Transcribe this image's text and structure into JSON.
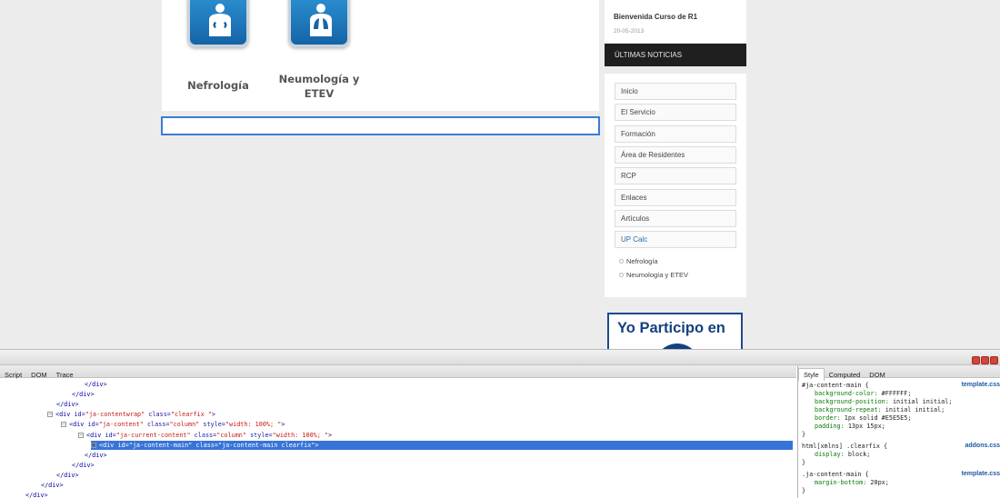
{
  "page": {
    "departments": [
      {
        "name_line1": "Nefrología",
        "name_line2": ""
      },
      {
        "name_line1": "Neumología y",
        "name_line2": "ETEV"
      }
    ],
    "welcome": {
      "title": "Bienvenida Curso de R1",
      "date": "20-05-2013"
    },
    "news_header": "ÚLTIMAS NOTICIAS",
    "menu": [
      "Inicio",
      "El Servicio",
      "Formación",
      "Área de Residentes",
      "RCP",
      "Enlaces",
      "Artículos",
      "UP Calc"
    ],
    "submenu": [
      "Nefrología",
      "Neumología y ETEV"
    ],
    "banner": "Yo Participo en"
  },
  "devtools": {
    "tabs": [
      "Script",
      "DOM",
      "Trace"
    ],
    "tree": [
      {
        "indent": 93,
        "close": "</div>"
      },
      {
        "indent": 79,
        "close": "</div>"
      },
      {
        "indent": 62,
        "close": "</div>"
      },
      {
        "indent": 52,
        "toggle": "−",
        "tag": "div",
        "attrs": [
          [
            "id",
            "ja-contentwrap"
          ],
          [
            "class",
            "clearfix "
          ]
        ]
      },
      {
        "indent": 67,
        "toggle": "−",
        "tag": "div",
        "attrs": [
          [
            "id",
            "ja-content"
          ],
          [
            "class",
            "column"
          ],
          [
            "style",
            "width: 100%; "
          ]
        ]
      },
      {
        "indent": 86,
        "toggle": "−",
        "tag": "div",
        "attrs": [
          [
            "id",
            "ja-current-content"
          ],
          [
            "class",
            "column"
          ],
          [
            "style",
            "width: 100%; "
          ]
        ]
      },
      {
        "indent": 100,
        "toggle": "+",
        "tag": "div",
        "attrs": [
          [
            "id",
            "ja-content-main"
          ],
          [
            "class",
            "ja-content-main clearfix"
          ]
        ],
        "selected": true
      },
      {
        "indent": 93,
        "close": "</div>"
      },
      {
        "indent": 79,
        "close": "</div>"
      },
      {
        "indent": 62,
        "close": "</div>"
      },
      {
        "indent": 45,
        "close": "</div>"
      },
      {
        "indent": 28,
        "close": "</div>"
      }
    ],
    "side_tabs": [
      "Style",
      "Computed",
      "DOM"
    ],
    "rules": [
      {
        "selector": "#ja-content-main {",
        "source": "template.css",
        "props": [
          [
            "background-color",
            "#FFFFFF;"
          ],
          [
            "background-position",
            "initial initial;"
          ],
          [
            "background-repeat",
            "initial initial;"
          ],
          [
            "border",
            "1px solid #E5E5E5;"
          ],
          [
            "padding",
            "13px 15px;"
          ]
        ]
      },
      {
        "selector": "html[xmlns] .clearfix {",
        "source": "addons.css",
        "props": [
          [
            "display",
            "block;"
          ]
        ]
      },
      {
        "selector": ".ja-content-main {",
        "source": "template.css",
        "props": [
          [
            "margin-bottom",
            "20px;"
          ]
        ]
      }
    ]
  },
  "colors": {
    "accent": "#3874d8",
    "banner": "#15407f",
    "news_bg": "#1f1f1f"
  }
}
